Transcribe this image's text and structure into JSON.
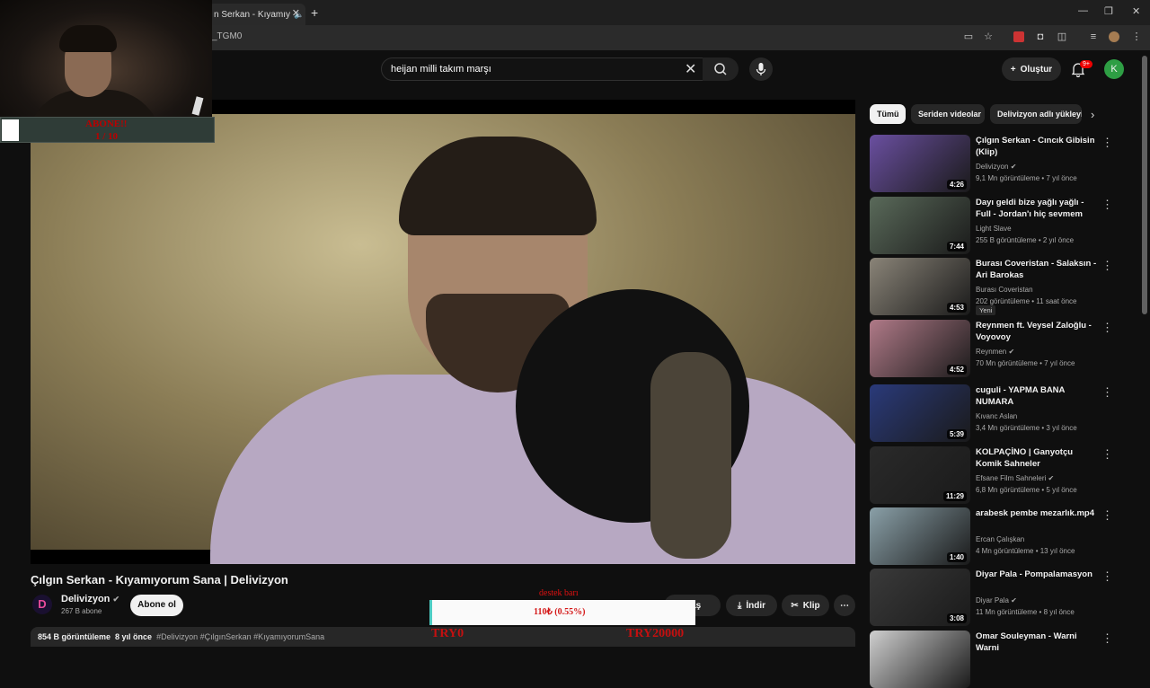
{
  "browser": {
    "tab_title": "n Serkan - Kıyamıy",
    "url_fragment": "_TGM0"
  },
  "header": {
    "search_value": "heijan milli takım marşı",
    "create_label": "Oluştur",
    "notifications_badge": "9+",
    "avatar_letter": "K"
  },
  "video": {
    "title": "Çılgın Serkan - Kıyamıyorum Sana | Delivizyon",
    "channel": {
      "logo_letter": "D",
      "name": "Delivizyon",
      "subscribers": "267 B abone",
      "subscribe_label": "Abone ol"
    },
    "actions": {
      "share_label": "ylaş",
      "download_label": "İndir",
      "clip_label": "Klip"
    },
    "description": {
      "views": "854 B görüntüleme",
      "age": "8 yıl önce",
      "tags": "#Delivizyon #ÇılgınSerkan #KıyamıyorumSana"
    }
  },
  "chips": [
    {
      "label": "Tümü",
      "active": true
    },
    {
      "label": "Seriden videolar",
      "active": false
    },
    {
      "label": "Delivizyon adlı yükleyi",
      "active": false
    }
  ],
  "recommendations": [
    {
      "title": "Çılgın Serkan - Cıncık Gibisin (Klip)",
      "channel": "Delivizyon",
      "verified": true,
      "meta": "9,1 Mn görüntüleme • 7 yıl önce",
      "duration": "4:26",
      "thumb_color": "#6a4fa0"
    },
    {
      "title": "Dayı geldi bize yağlı yağlı - Full - Jordan'ı hiç sevmem",
      "channel": "Light Slave",
      "verified": false,
      "meta": "255 B görüntüleme • 2 yıl önce",
      "duration": "7:44",
      "thumb_color": "#5a6a5a"
    },
    {
      "title": "Burası Coveristan - Salaksın - Ari Barokas",
      "channel": "Burası Coveristan",
      "verified": false,
      "meta": "202 görüntüleme • 11 saat önce",
      "duration": "4:53",
      "badge": "Yeni",
      "thumb_color": "#8a8478"
    },
    {
      "title": "Reynmen ft. Veysel Zaloğlu - Voyovoy",
      "channel": "Reynmen",
      "verified": true,
      "meta": "70 Mn görüntüleme • 7 yıl önce",
      "duration": "4:52",
      "thumb_color": "#b07a88"
    },
    {
      "title": "cuguli - YAPMA BANA NUMARA",
      "channel": "Kıvanc Aslan",
      "verified": false,
      "meta": "3,4 Mn görüntüleme • 3 yıl önce",
      "duration": "5:39",
      "thumb_color": "#2a3a7a"
    },
    {
      "title": "KOLPAÇİNO | Ganyotçu Komik Sahneler",
      "channel": "Efsane Film Sahneleri",
      "verified": true,
      "meta": "6,8 Mn görüntüleme • 5 yıl önce",
      "duration": "11:29",
      "thumb_color": "#2a2a2a"
    },
    {
      "title": "arabesk pembe mezarlık.mp4",
      "channel": "Ercan Çalışkan",
      "verified": false,
      "meta": "4 Mn görüntüleme • 13 yıl önce",
      "duration": "1:40",
      "thumb_color": "#8aa0a8"
    },
    {
      "title": "Diyar Pala - Pompalamasyon",
      "channel": "Diyar Pala",
      "verified": true,
      "meta": "11 Mn görüntüleme • 8 yıl önce",
      "duration": "3:08",
      "thumb_color": "#3a3a3a"
    },
    {
      "title": "Omar Souleyman - Warni Warni",
      "channel": "",
      "verified": false,
      "meta": "",
      "duration": "",
      "thumb_color": "#cfcfcf"
    }
  ],
  "overlays": {
    "goal_title": "ABONE!!",
    "goal_count": "1 / 10",
    "goal_progress": 0.1,
    "donation_title": "destek barı",
    "donation_value": "110₺ (0.55%)",
    "donation_progress": 0.0055,
    "donation_min": "TRY0",
    "donation_max": "TRY20000"
  }
}
